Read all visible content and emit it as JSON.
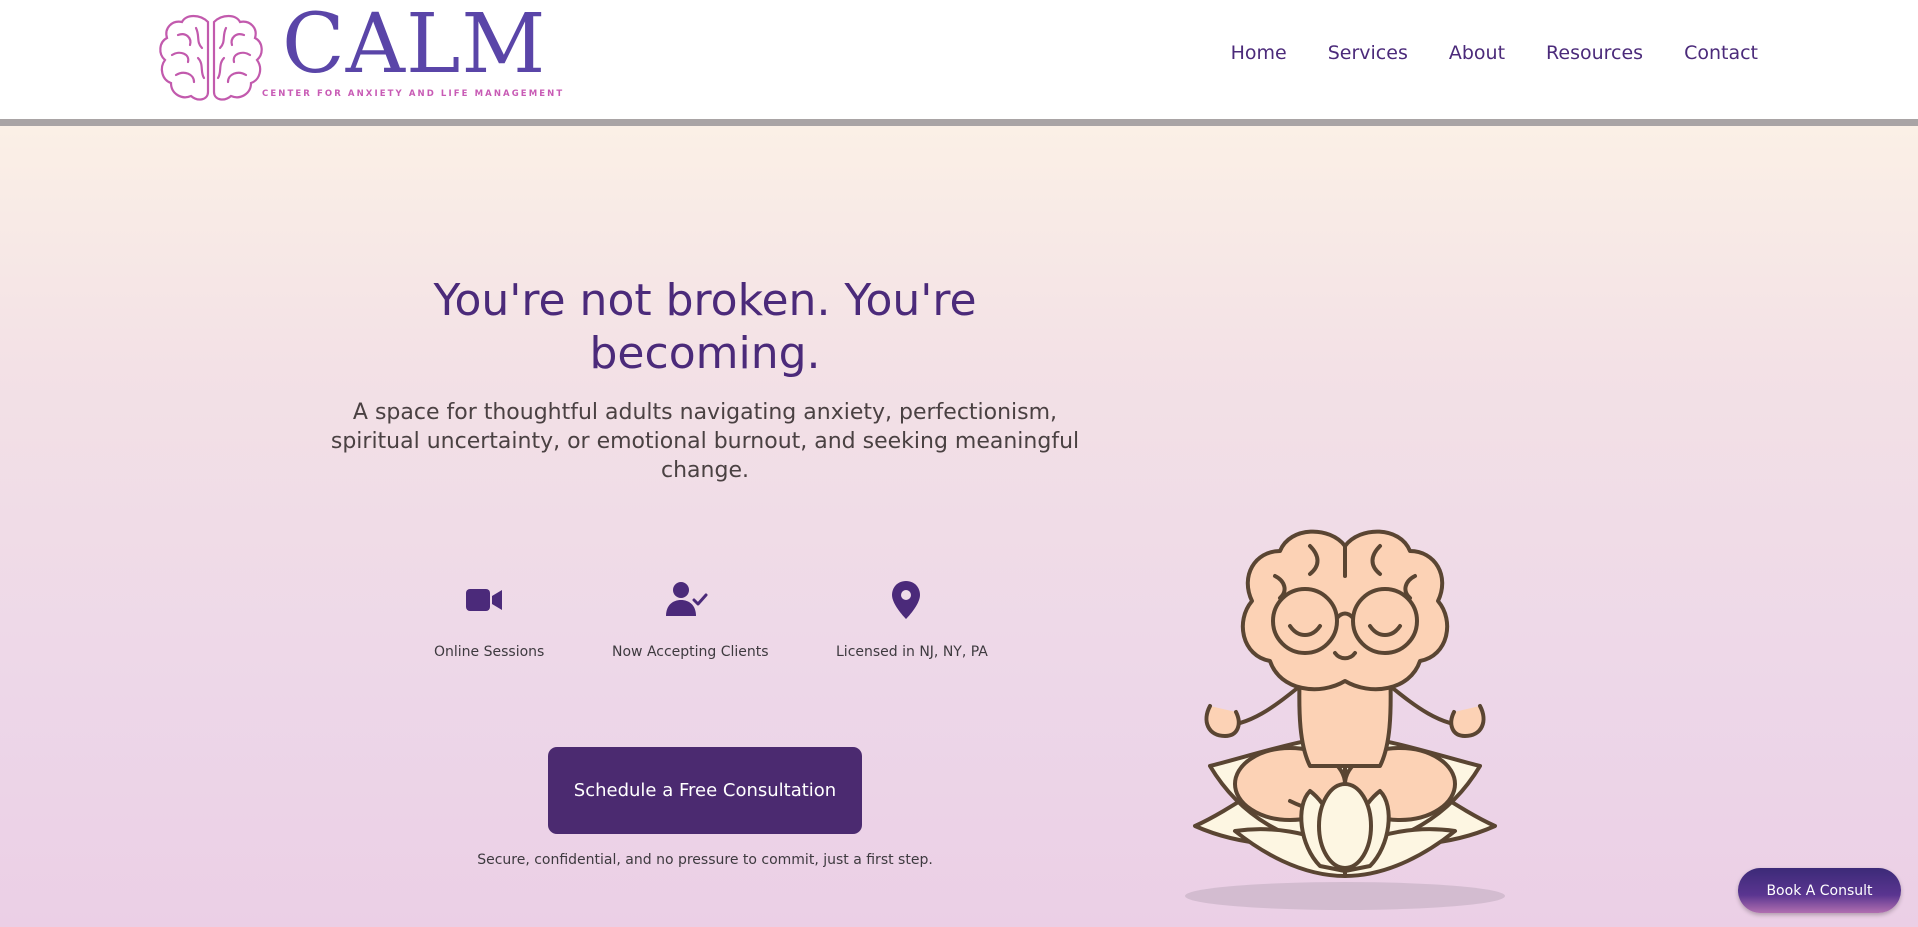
{
  "brand": {
    "wordmark": "CALM",
    "tagline": "CENTER FOR ANXIETY AND LIFE MANAGEMENT",
    "primary_color": "#4b2a7a",
    "logo_color": "#5a45a8",
    "accent_color": "#c85bb5"
  },
  "nav": {
    "items": [
      {
        "label": "Home"
      },
      {
        "label": "Services"
      },
      {
        "label": "About"
      },
      {
        "label": "Resources"
      },
      {
        "label": "Contact"
      }
    ]
  },
  "hero": {
    "title": "You're not broken. You're becoming.",
    "subtitle": "A space for thoughtful adults navigating anxiety, perfectionism, spiritual uncertainty, or emotional burnout, and seeking meaningful change.",
    "features": [
      {
        "icon": "video-camera-icon",
        "label": "Online Sessions"
      },
      {
        "icon": "user-check-icon",
        "label": "Now Accepting Clients"
      },
      {
        "icon": "map-pin-icon",
        "label": "Licensed in NJ, NY, PA"
      }
    ],
    "cta_label": "Schedule a Free Consultation",
    "cta_note": "Secure, confidential, and no pressure to commit, just a first step.",
    "illustration": "meditating-brain-on-lotus"
  },
  "floating": {
    "book_label": "Book A Consult"
  }
}
